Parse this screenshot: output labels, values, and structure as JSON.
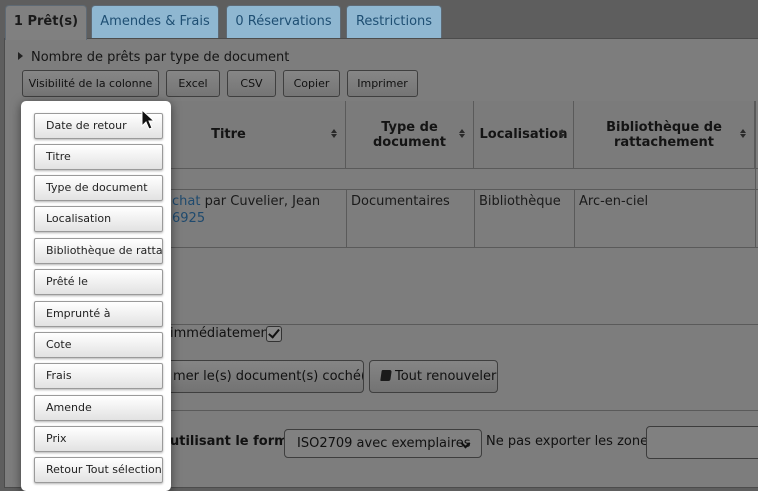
{
  "tabs": [
    {
      "label": "1 Prêt(s)",
      "active": true
    },
    {
      "label": "Amendes & Frais",
      "active": false
    },
    {
      "label": "0 Réservations",
      "active": false
    },
    {
      "label": "Restrictions",
      "active": false
    }
  ],
  "section": {
    "caption": "Nombre de prêts par type de document"
  },
  "toolbar": {
    "column_visibility": "Visibilité de la colonne",
    "excel": "Excel",
    "csv": "CSV",
    "copy": "Copier",
    "print": "Imprimer"
  },
  "table": {
    "headers": [
      "Titre",
      "Type de document",
      "Localisation",
      "Bibliothèque de rattachement"
    ],
    "row": {
      "title_link": "chat",
      "title_rest": " par Cuvelier, Jean",
      "barcode": "6925",
      "type": "Documentaires",
      "location": "Bibliothèque",
      "library": "Arc-en-ciel"
    }
  },
  "renew": {
    "immediate_label": "immédiatement",
    "immediate_checked": true,
    "renew_checked_label": "mer le(s) document(s) coché(s)",
    "renew_all_label": "Tout renouveler"
  },
  "export": {
    "format_label": "utilisant le format:",
    "format_value": "ISO2709 avec exemplaires",
    "exclude_label": "Ne pas exporter les zones:",
    "exclude_value": ""
  },
  "column_menu": [
    "Date de retour",
    "Titre",
    "Type de document",
    "Localisation",
    "Bibliothèque de rattachement",
    "Prêté le",
    "Emprunté à",
    "Cote",
    "Frais",
    "Amende",
    "Prix",
    "Retour Tout sélectionner"
  ],
  "colors": {
    "overlay": "#5e5e5e",
    "tab": "#8fb7d1",
    "popup": "#ffffff"
  }
}
